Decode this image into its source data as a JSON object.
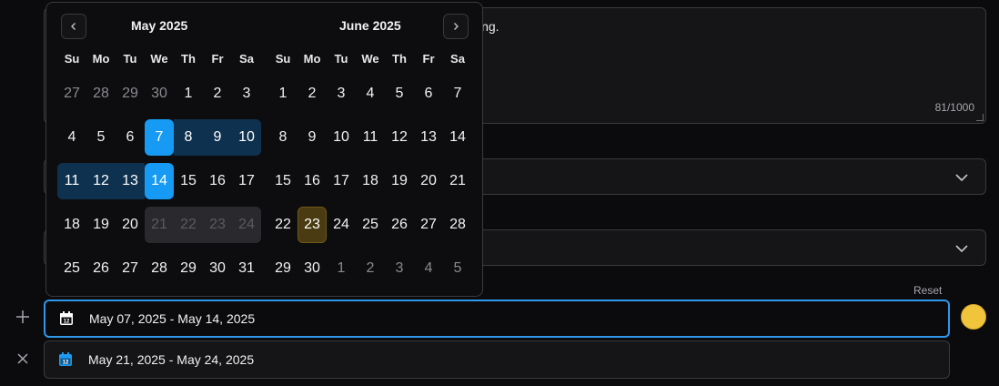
{
  "textarea": {
    "visible_text": "sing.",
    "counter": "81/1000"
  },
  "reset_label": "Reset",
  "date_ranges": [
    {
      "value": "May 07, 2025 - May 14, 2025",
      "icon": "calendar-icon",
      "active": true
    },
    {
      "value": "May 21, 2025 - May 24, 2025",
      "icon": "calendar-icon",
      "active": false
    }
  ],
  "color_swatch": "#f0c43b",
  "calendar": {
    "weekdays": [
      "Su",
      "Mo",
      "Tu",
      "We",
      "Th",
      "Fr",
      "Sa"
    ],
    "months": [
      {
        "title": "May 2025",
        "days": [
          {
            "d": "27",
            "s": "outside"
          },
          {
            "d": "28",
            "s": "outside"
          },
          {
            "d": "29",
            "s": "outside"
          },
          {
            "d": "30",
            "s": "outside"
          },
          {
            "d": "1",
            "s": ""
          },
          {
            "d": "2",
            "s": ""
          },
          {
            "d": "3",
            "s": ""
          },
          {
            "d": "4",
            "s": ""
          },
          {
            "d": "5",
            "s": ""
          },
          {
            "d": "6",
            "s": ""
          },
          {
            "d": "7",
            "s": "selected"
          },
          {
            "d": "8",
            "s": "range"
          },
          {
            "d": "9",
            "s": "range"
          },
          {
            "d": "10",
            "s": "range range-end"
          },
          {
            "d": "11",
            "s": "range range-start"
          },
          {
            "d": "12",
            "s": "range"
          },
          {
            "d": "13",
            "s": "range"
          },
          {
            "d": "14",
            "s": "selected"
          },
          {
            "d": "15",
            "s": ""
          },
          {
            "d": "16",
            "s": ""
          },
          {
            "d": "17",
            "s": ""
          },
          {
            "d": "18",
            "s": ""
          },
          {
            "d": "19",
            "s": ""
          },
          {
            "d": "20",
            "s": ""
          },
          {
            "d": "21",
            "s": "disabled dis-start"
          },
          {
            "d": "22",
            "s": "disabled"
          },
          {
            "d": "23",
            "s": "disabled"
          },
          {
            "d": "24",
            "s": "disabled dis-end"
          },
          {
            "d": "25",
            "s": ""
          },
          {
            "d": "26",
            "s": ""
          },
          {
            "d": "27",
            "s": ""
          },
          {
            "d": "28",
            "s": ""
          },
          {
            "d": "29",
            "s": ""
          },
          {
            "d": "30",
            "s": ""
          },
          {
            "d": "31",
            "s": ""
          }
        ]
      },
      {
        "title": "June 2025",
        "days": [
          {
            "d": "1",
            "s": ""
          },
          {
            "d": "2",
            "s": ""
          },
          {
            "d": "3",
            "s": ""
          },
          {
            "d": "4",
            "s": ""
          },
          {
            "d": "5",
            "s": ""
          },
          {
            "d": "6",
            "s": ""
          },
          {
            "d": "7",
            "s": ""
          },
          {
            "d": "8",
            "s": ""
          },
          {
            "d": "9",
            "s": ""
          },
          {
            "d": "10",
            "s": ""
          },
          {
            "d": "11",
            "s": ""
          },
          {
            "d": "12",
            "s": ""
          },
          {
            "d": "13",
            "s": ""
          },
          {
            "d": "14",
            "s": ""
          },
          {
            "d": "15",
            "s": ""
          },
          {
            "d": "16",
            "s": ""
          },
          {
            "d": "17",
            "s": ""
          },
          {
            "d": "18",
            "s": ""
          },
          {
            "d": "19",
            "s": ""
          },
          {
            "d": "20",
            "s": ""
          },
          {
            "d": "21",
            "s": ""
          },
          {
            "d": "22",
            "s": ""
          },
          {
            "d": "23",
            "s": "today"
          },
          {
            "d": "24",
            "s": ""
          },
          {
            "d": "25",
            "s": ""
          },
          {
            "d": "26",
            "s": ""
          },
          {
            "d": "27",
            "s": ""
          },
          {
            "d": "28",
            "s": ""
          },
          {
            "d": "29",
            "s": ""
          },
          {
            "d": "30",
            "s": ""
          },
          {
            "d": "1",
            "s": "outside"
          },
          {
            "d": "2",
            "s": "outside"
          },
          {
            "d": "3",
            "s": "outside"
          },
          {
            "d": "4",
            "s": "outside"
          },
          {
            "d": "5",
            "s": "outside"
          }
        ]
      }
    ]
  }
}
